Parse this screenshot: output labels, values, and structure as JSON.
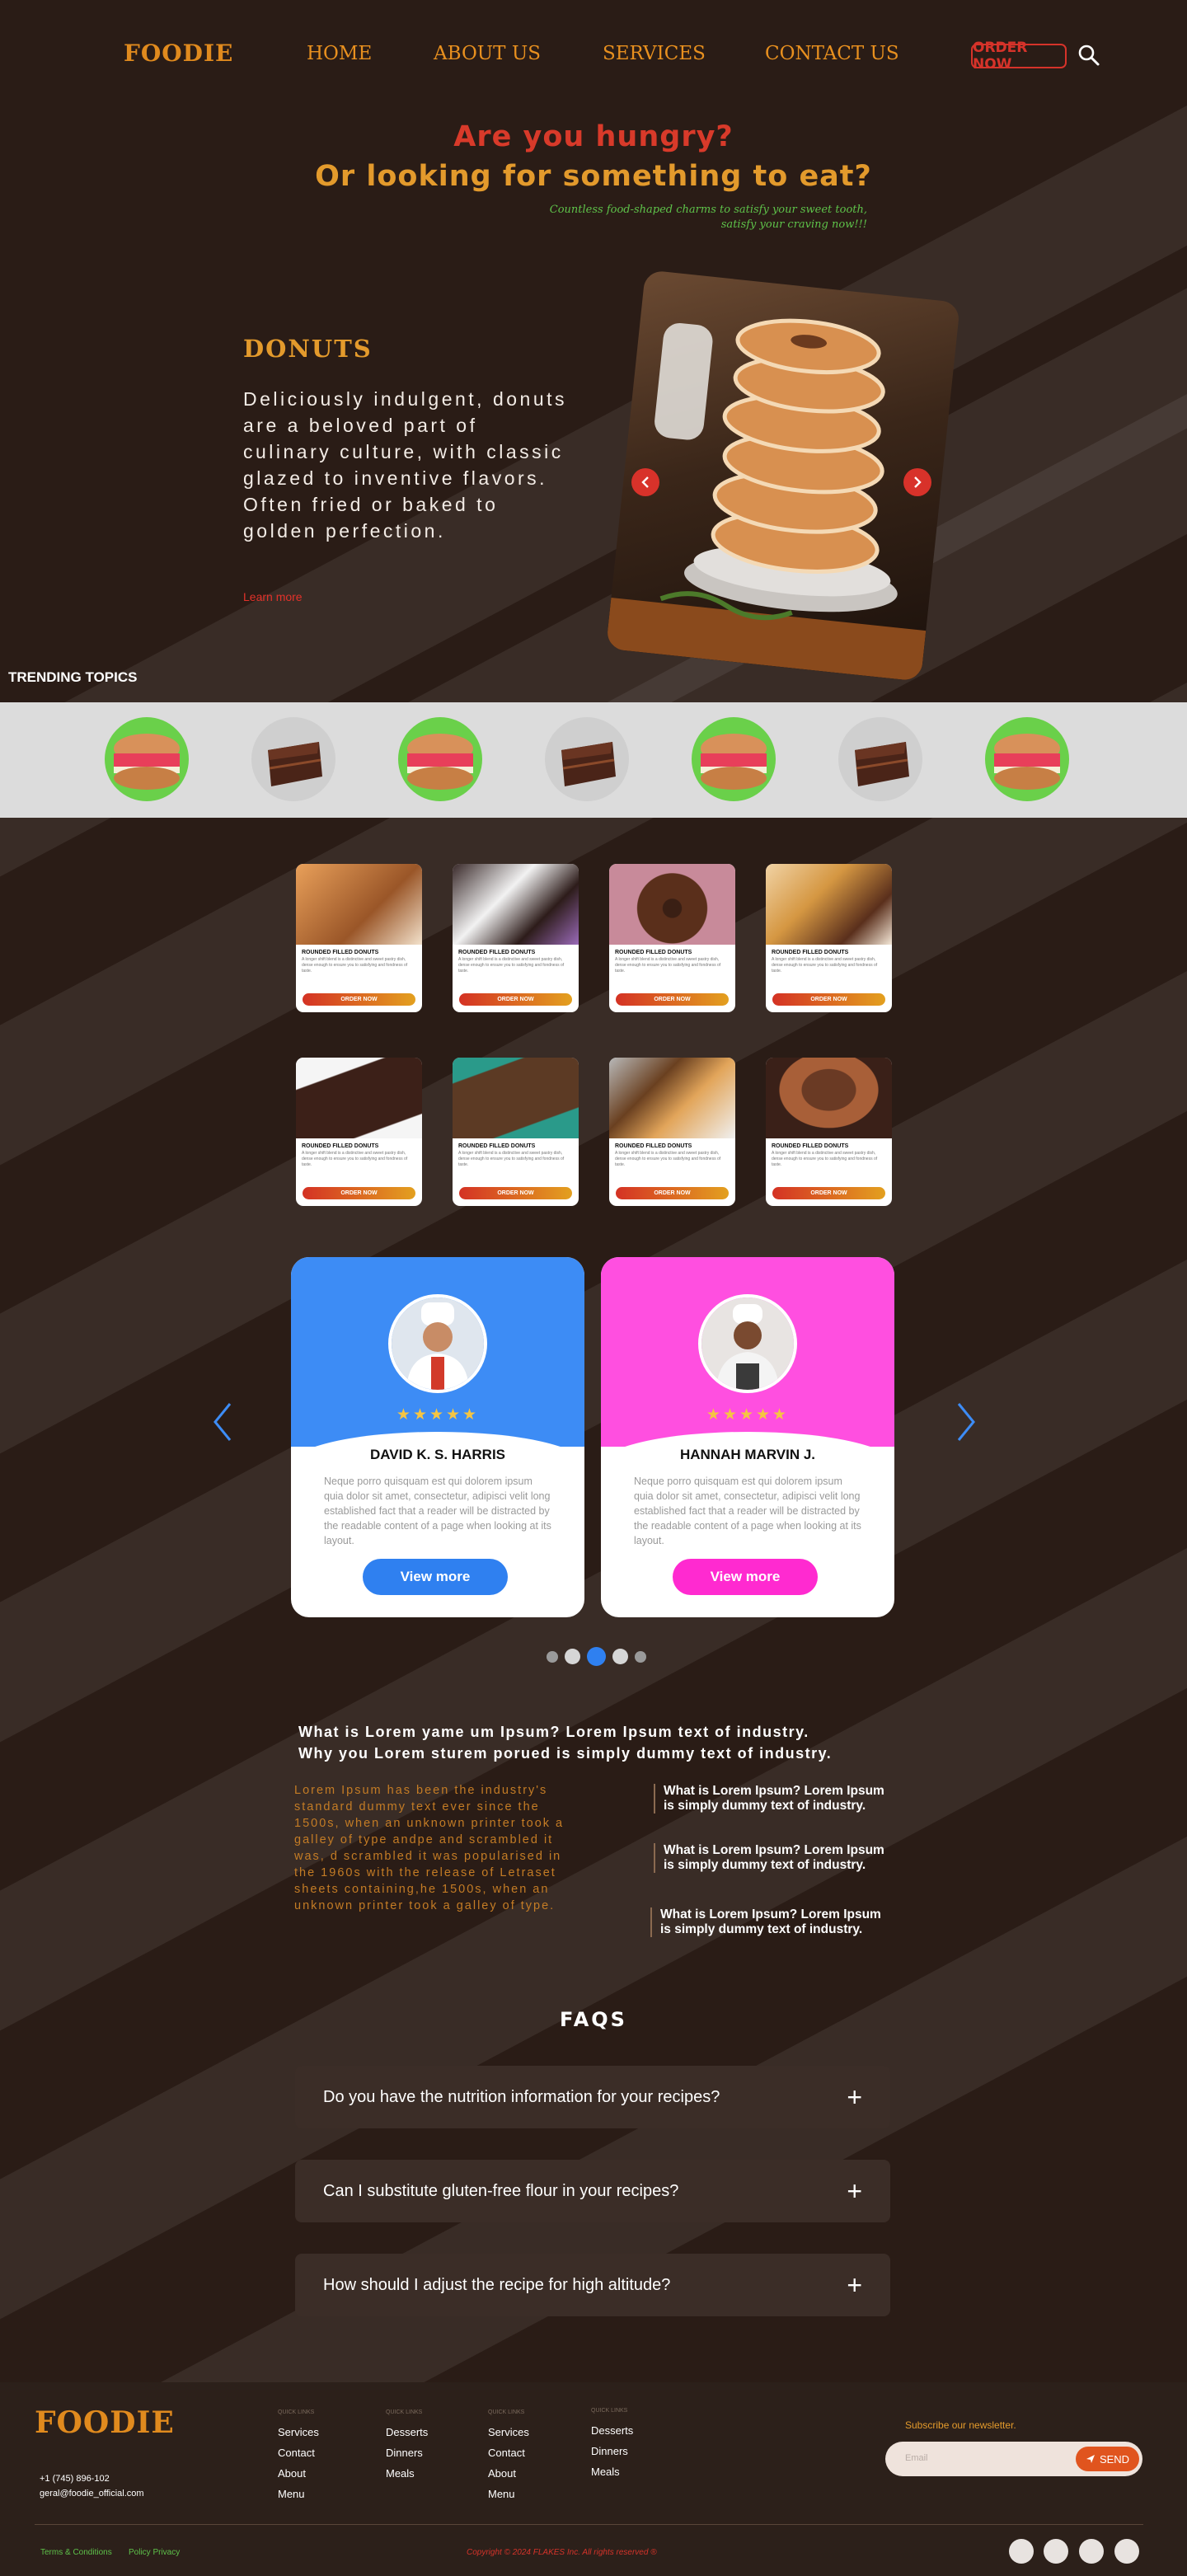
{
  "brand": {
    "name": "FOODIE"
  },
  "nav": {
    "home": "HOME",
    "about": "ABOUT US",
    "services": "SERVICES",
    "contact": "CONTACT US",
    "order": "ORDER NOW"
  },
  "hero": {
    "line1": "Are you hungry?",
    "line2": "Or looking for something to eat?",
    "tagline": "Countless food-shaped charms to satisfy your sweet tooth, satisfy your craving now!!!",
    "title": "DONUTS",
    "text": "Deliciously indulgent, donuts are a beloved part of culinary culture, with classic glazed to inventive flavors. Often fried or baked to golden perfection.",
    "learn_more": "Learn more"
  },
  "trending": {
    "label": "TRENDING TOPICS"
  },
  "products": [
    {
      "title": "ROUNDED FILLED DONUTS",
      "desc": "A longer shift blend is a distinctive and sweet pastry dish, dense enough to ensure you to satisfying and fondness of taste.",
      "button": "ORDER NOW"
    }
  ],
  "testimonials": [
    {
      "name": "DAVID K. S. HARRIS",
      "text": "Neque porro quisquam est qui dolorem ipsum quia dolor sit amet, consectetur, adipisci velit long established fact that a reader will be distracted by the readable content of a page when looking at its layout.",
      "button": "View more",
      "color": "#3d8cf5",
      "btn_color": "#2f80f0"
    },
    {
      "name": "HANNAH MARVIN J.",
      "text": "Neque porro quisquam est qui dolorem ipsum quia dolor sit amet, consectetur, adipisci velit long established fact that a reader will be distracted by the readable content of a page when looking at its layout.",
      "button": "View more",
      "color": "#ff4fe0",
      "btn_color": "#ff2ad0"
    }
  ],
  "stars": "★★★★★",
  "about": {
    "question_line1": "What is Lorem yame um Ipsum? Lorem Ipsum  text of industry.",
    "question_line2": "Why you Lorem sturem porued is simply dummy text of industry.",
    "lorem": "Lorem Ipsum has been the industry's standard dummy text ever since the 1500s, when an unknown printer took a galley of type andpe and scrambled it was, d scrambled it was popularised in the 1960s with the release of Letraset sheets containing,he 1500s, when an unknown printer took a galley of type.",
    "side": [
      "What is Lorem Ipsum? Lorem Ipsum is simply dummy text of industry.",
      "What is Lorem Ipsum? Lorem Ipsum is simply dummy text of industry.",
      "What is Lorem Ipsum? Lorem Ipsum is simply dummy text of industry."
    ]
  },
  "faq": {
    "title": "FAQS",
    "items": [
      "Do you have the nutrition information for your recipes?",
      "Can I substitute gluten-free flour in your recipes?",
      "How should I adjust the recipe for high altitude?"
    ],
    "toggle": "+"
  },
  "footer": {
    "phone": "+1 (745) 896-102",
    "email": "geral@foodie_official.com",
    "col_heading": "QUICK LINKS",
    "col1": [
      "Services",
      "Contact",
      "About",
      "Menu"
    ],
    "col2": [
      "Desserts",
      "Dinners",
      "Meals"
    ],
    "col3": [
      "Services",
      "Contact",
      "About",
      "Menu"
    ],
    "col4": [
      "Desserts",
      "Dinners",
      "Meals"
    ],
    "newsletter": "Subscribe our newsletter.",
    "email_placeholder": "Email",
    "send": "SEND",
    "terms": "Terms & Conditions",
    "privacy": "Policy Privacy",
    "copyright": "Copyright © 2024 FLAKES Inc. All rights reserved ®"
  }
}
